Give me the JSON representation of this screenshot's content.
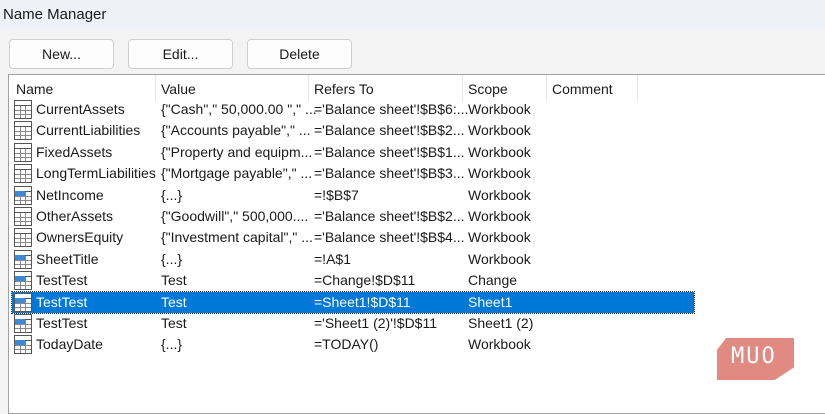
{
  "window": {
    "title": "Name Manager"
  },
  "buttons": {
    "new": "New...",
    "edit": "Edit...",
    "delete": "Delete"
  },
  "columns": [
    "Name",
    "Value",
    "Refers To",
    "Scope",
    "Comment"
  ],
  "rows": [
    {
      "name": "CurrentAssets",
      "value": "{\"Cash\",\" 50,000.00 \",\" ...",
      "refers": "='Balance sheet'!$B$6:...",
      "scope": "Workbook",
      "icon": "range"
    },
    {
      "name": "CurrentLiabilities",
      "value": "{\"Accounts payable\",\" ...",
      "refers": "='Balance sheet'!$B$2...",
      "scope": "Workbook",
      "icon": "range"
    },
    {
      "name": "FixedAssets",
      "value": "{\"Property and equipm...",
      "refers": "='Balance sheet'!$B$1...",
      "scope": "Workbook",
      "icon": "range"
    },
    {
      "name": "LongTermLiabilities",
      "value": "{\"Mortgage payable\",\" ...",
      "refers": "='Balance sheet'!$B$3...",
      "scope": "Workbook",
      "icon": "range"
    },
    {
      "name": "NetIncome",
      "value": "{...}",
      "refers": "=!$B$7",
      "scope": "Workbook",
      "icon": "cell"
    },
    {
      "name": "OtherAssets",
      "value": "{\"Goodwill\",\" 500,000....",
      "refers": "='Balance sheet'!$B$2...",
      "scope": "Workbook",
      "icon": "range"
    },
    {
      "name": "OwnersEquity",
      "value": "{\"Investment capital\",\" ...",
      "refers": "='Balance sheet'!$B$4...",
      "scope": "Workbook",
      "icon": "range"
    },
    {
      "name": "SheetTitle",
      "value": "{...}",
      "refers": "=!A$1",
      "scope": "Workbook",
      "icon": "cell"
    },
    {
      "name": "TestTest",
      "value": "Test",
      "refers": "=Change!$D$11",
      "scope": "Change",
      "icon": "cell"
    },
    {
      "name": "TestTest",
      "value": "Test",
      "refers": "=Sheet1!$D$11",
      "scope": "Sheet1",
      "icon": "cell",
      "selected": true
    },
    {
      "name": "TestTest",
      "value": "Test",
      "refers": "='Sheet1 (2)'!$D$11",
      "scope": "Sheet1 (2)",
      "icon": "cell"
    },
    {
      "name": "TodayDate",
      "value": "{...}",
      "refers": "=TODAY()",
      "scope": "Workbook",
      "icon": "cell"
    }
  ],
  "watermark": "MUO",
  "colors": {
    "selection": "#0078d7",
    "logo": "#e08a82"
  }
}
